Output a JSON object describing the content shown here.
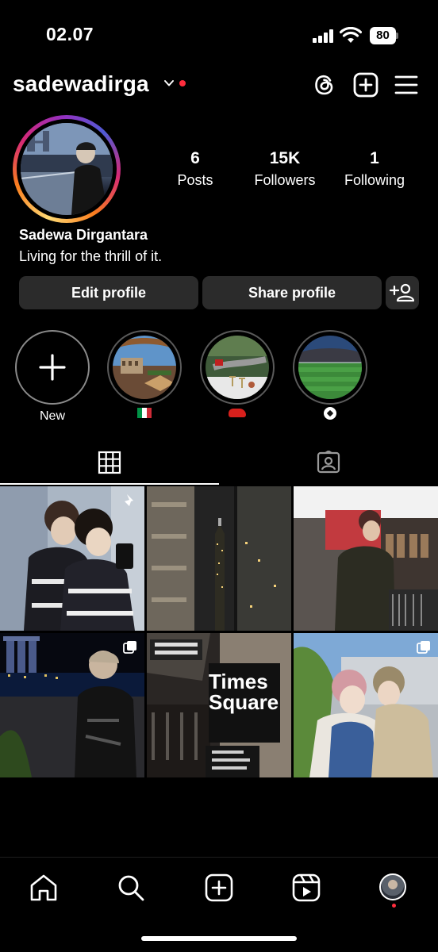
{
  "status_bar": {
    "time": "02.07",
    "battery": "80"
  },
  "header": {
    "username": "sadewadirga"
  },
  "profile": {
    "stats": [
      {
        "value": "6",
        "label": "Posts"
      },
      {
        "value": "15K",
        "label": "Followers"
      },
      {
        "value": "1",
        "label": "Following"
      }
    ],
    "full_name": "Sadewa Dirgantara",
    "bio": "Living for the thrill of it.",
    "edit_label": "Edit profile",
    "share_label": "Share profile"
  },
  "highlights": [
    {
      "label": "New",
      "kind": "new"
    },
    {
      "label": "",
      "kind": "italy-flag"
    },
    {
      "label": "",
      "kind": "red-car"
    },
    {
      "label": "",
      "kind": "soccer-ball"
    }
  ],
  "tabs": [
    "grid-icon",
    "tagged-icon"
  ],
  "posts": [
    {
      "icon": "pin-icon",
      "multi": false
    },
    {
      "icon": "",
      "multi": false
    },
    {
      "icon": "",
      "multi": false
    },
    {
      "icon": "multiple-photos-icon",
      "multi": true
    },
    {
      "icon": "",
      "multi": false
    },
    {
      "icon": "multiple-photos-icon",
      "multi": true
    }
  ],
  "nav": [
    "home-icon",
    "search-icon",
    "create-icon",
    "reels-icon",
    "profile-avatar"
  ],
  "colors": {
    "background": "#000000",
    "button": "#2b2b2b",
    "notification": "#ff2d3d"
  }
}
